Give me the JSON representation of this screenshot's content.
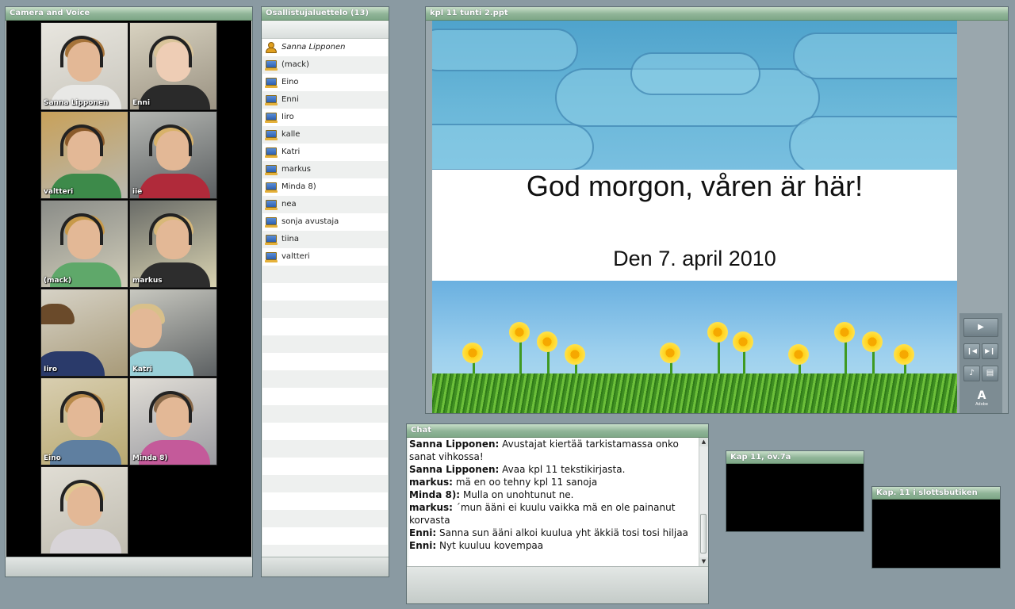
{
  "camera_pod": {
    "title": "Camera and Voice",
    "videos": [
      {
        "name": "Sanna Lipponen"
      },
      {
        "name": "Enni"
      },
      {
        "name": "valtteri"
      },
      {
        "name": "iie"
      },
      {
        "name": "(mack)"
      },
      {
        "name": "markus"
      },
      {
        "name": "Iiro"
      },
      {
        "name": "Katri"
      },
      {
        "name": "Eino"
      },
      {
        "name": "Minda 8)"
      },
      {
        "name": ""
      }
    ]
  },
  "attendee_pod": {
    "title": "Osallistujaluettelo (13)",
    "host": "Sanna Lipponen",
    "participants": [
      "(mack)",
      "Eino",
      "Enni",
      "Iiro",
      "kalle",
      "Katri",
      "markus",
      "Minda 8)",
      "nea",
      "sonja avustaja",
      "tiina",
      "valtteri"
    ]
  },
  "share_pod": {
    "title": "kpl 11 tunti 2.ppt",
    "slide_title": "God morgon, våren är här!",
    "slide_date": "Den 7. april 2010",
    "brand": "Adobe"
  },
  "chat_pod": {
    "title": "Chat",
    "messages": [
      {
        "who": "Sanna Lipponen:",
        "text": "Avustajat kiertää tarkistamassa onko sanat vihkossa!"
      },
      {
        "who": "Sanna Lipponen:",
        "text": "Avaa kpl 11 tekstikirjasta."
      },
      {
        "who": "markus:",
        "text": "mä en oo tehny kpl 11 sanoja"
      },
      {
        "who": "Minda 8):",
        "text": "Mulla on unohtunut ne."
      },
      {
        "who": "markus:",
        "text": "´mun ääni ei kuulu vaikka mä en ole painanut korvasta"
      },
      {
        "who": "Enni:",
        "text": "Sanna sun ääni alkoi kuulua yht äkkiä tosi tosi hiljaa"
      },
      {
        "who": "Enni:",
        "text": "Nyt kuuluu kovempaa"
      }
    ]
  },
  "video_pods": {
    "pod1_title": "Kap 11, öv.7a",
    "pod2_title": "Kap. 11 i slottsbutiken"
  }
}
